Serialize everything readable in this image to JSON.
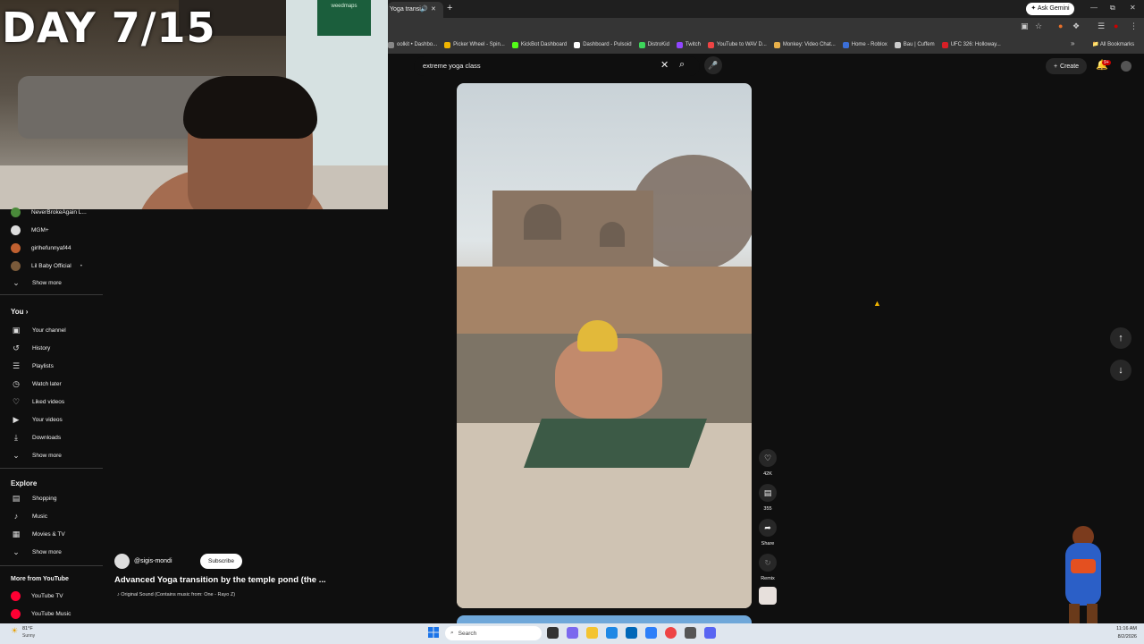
{
  "overlay": {
    "day_text": "DAY 7/15",
    "poster_text": "weedmaps"
  },
  "browser": {
    "tab_title": "Yoga transi",
    "ask_gemini": "Ask Gemini",
    "bookmarks": [
      {
        "label": "oolkit • Dashbo...",
        "color": "#888888"
      },
      {
        "label": "Picker Wheel - Spin...",
        "color": "#f0b400"
      },
      {
        "label": "KickBot Dashboard",
        "color": "#53fc18"
      },
      {
        "label": "Dashboard - Pulsoid",
        "color": "#ffffff"
      },
      {
        "label": "DistroKid",
        "color": "#3dd65b"
      },
      {
        "label": "Twitch",
        "color": "#9146ff"
      },
      {
        "label": "YouTube to WAV D...",
        "color": "#e44"
      },
      {
        "label": "Monkey: Video Chat...",
        "color": "#e8b04a"
      },
      {
        "label": "Home - Roblox",
        "color": "#3b6fd8"
      },
      {
        "label": "Bau | Cuffem",
        "color": "#cccccc"
      },
      {
        "label": "UFC 326: Holloway...",
        "color": "#d81f26"
      }
    ],
    "all_bookmarks": "All Bookmarks"
  },
  "sidebar": {
    "subscriptions": [
      {
        "label": "NeverBrokeAgain L...",
        "color": "#4a8a3a",
        "dot": false
      },
      {
        "label": "MGM+",
        "color": "#dddddd",
        "dot": false
      },
      {
        "label": "girlhefunnyaf44",
        "color": "#c06030",
        "dot": false
      },
      {
        "label": "Lil Baby Official",
        "color": "#7a5a3a",
        "dot": true
      }
    ],
    "show_more_1": "Show more",
    "you_heading": "You",
    "you_items": [
      {
        "label": "Your channel",
        "icon": "▣",
        "name": "your-channel-icon"
      },
      {
        "label": "History",
        "icon": "↺",
        "name": "history-icon"
      },
      {
        "label": "Playlists",
        "icon": "☰",
        "name": "playlists-icon"
      },
      {
        "label": "Watch later",
        "icon": "◷",
        "name": "watch-later-icon"
      },
      {
        "label": "Liked videos",
        "icon": "♡",
        "name": "like-icon"
      },
      {
        "label": "Your videos",
        "icon": "▶",
        "name": "your-videos-icon"
      },
      {
        "label": "Downloads",
        "icon": "⤓",
        "name": "download-icon"
      }
    ],
    "show_more_2": "Show more",
    "explore_heading": "Explore",
    "explore_items": [
      {
        "label": "Shopping",
        "icon": "▤",
        "name": "shopping-icon"
      },
      {
        "label": "Music",
        "icon": "♪",
        "name": "music-icon"
      },
      {
        "label": "Movies & TV",
        "icon": "▦",
        "name": "movies-icon"
      }
    ],
    "show_more_3": "Show more",
    "more_heading": "More from YouTube",
    "more_items": [
      {
        "label": "YouTube TV",
        "color": "#ff0033"
      },
      {
        "label": "YouTube Music",
        "color": "#ff0033"
      }
    ]
  },
  "search": {
    "value": "extreme yoga class"
  },
  "header": {
    "create_label": "Create",
    "notif_badge": "9+"
  },
  "short": {
    "likes": "42K",
    "comments": "355",
    "share_label": "Share",
    "remix_label": "Remix",
    "channel_handle": "@sigis-mondi",
    "subscribe_label": "Subscribe",
    "title": "Advanced Yoga transition by the temple pond (the ...",
    "sound": "Original Sound (Contains music from: One - Rayo Z)"
  },
  "taskbar": {
    "temp": "81°F",
    "condition": "Sunny",
    "search_placeholder": "Search",
    "time": "11:16 AM",
    "date": "8/2/2026"
  },
  "colors": {
    "accent_red": "#cc0000",
    "bg": "#0f0f0f"
  }
}
